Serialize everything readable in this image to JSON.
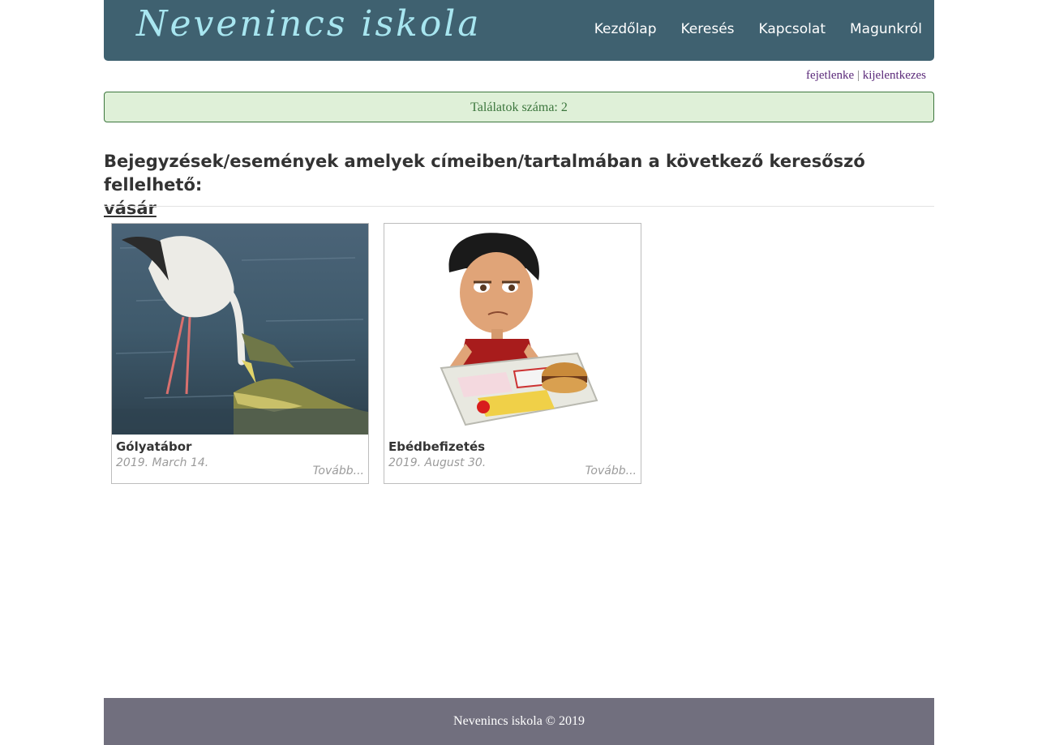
{
  "site": {
    "brand": "Nevenincs iskola"
  },
  "nav": {
    "items": [
      {
        "label": "Kezdőlap"
      },
      {
        "label": "Keresés"
      },
      {
        "label": "Kapcsolat"
      },
      {
        "label": "Magunkról"
      }
    ]
  },
  "user": {
    "name": "fejetlenke",
    "separator": "|",
    "logout": "kijelentkezes"
  },
  "results": {
    "count_text": "Találatok száma: 2",
    "heading": "Bejegyzések/események amelyek címeiben/tartalmában a következő keresőszó fellelhető:",
    "term": "vásár"
  },
  "cards": [
    {
      "title": "Gólyatábor",
      "date": "2019. March 14.",
      "more": "Tovább..."
    },
    {
      "title": "Ebédbefizetés",
      "date": "2019. August 30.",
      "more": "Tovább..."
    }
  ],
  "footer": {
    "text": "Nevenincs iskola © 2019"
  },
  "colors": {
    "navbar": "#3f6170",
    "brand": "#a8e6f0",
    "alert_bg": "#dff0d8",
    "alert_text": "#3c763d",
    "footer_bg": "#716f7e",
    "link": "#5b2a7a"
  }
}
